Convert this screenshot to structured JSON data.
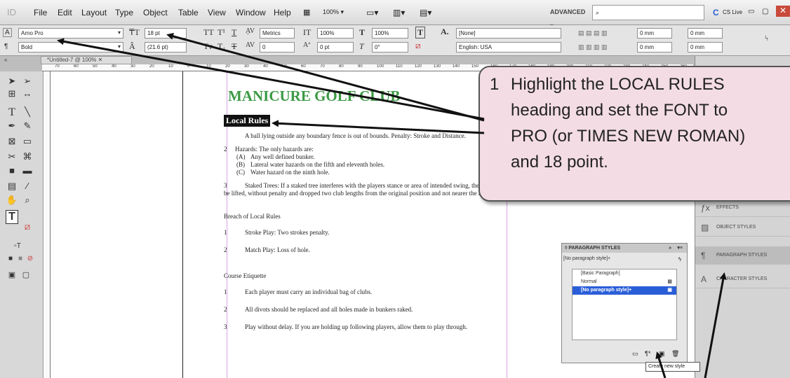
{
  "menubar": {
    "logo": "ID",
    "items": [
      "File",
      "Edit",
      "Layout",
      "Type",
      "Object",
      "Table",
      "View",
      "Window",
      "Help"
    ],
    "zoom": "100%",
    "workspace": "ADVANCED",
    "search_placeholder": "",
    "cslive": "CS Live"
  },
  "control": {
    "font_family": "Arno Pro",
    "font_style": "Bold",
    "font_size": "18 pt",
    "leading": "(21.6 pt)",
    "kerning": "Metrics",
    "tracking": "0",
    "vscale": "100%",
    "hscale": "100%",
    "baseline": "0 pt",
    "skew": "0°",
    "char_style": "[None]",
    "language": "English: USA",
    "indent1": "0 mm",
    "indent2": "0 mm",
    "indent3": "0 mm",
    "indent4": "0 mm"
  },
  "document": {
    "tab_title": "*Untitled-7 @ 100%",
    "ruler_ticks": [
      "70",
      "60",
      "50",
      "40",
      "30",
      "20",
      "10",
      "0",
      "10",
      "20",
      "30",
      "40",
      "50",
      "60",
      "70",
      "80",
      "90",
      "100",
      "110",
      "120",
      "130",
      "140",
      "150",
      "160",
      "170",
      "180",
      "190",
      "200",
      "210",
      "220",
      "230",
      "240",
      "250",
      "260",
      "270",
      "280"
    ],
    "title": "MANICURE GOLF CLUB",
    "local_rules": "Local Rules",
    "rule1": "A ball lying outside any boundary fence is out of bounds.  Penalty: Stroke and Distance.",
    "rule2": "Hazards:  The only hazards are:",
    "rule2a_k": "(A)",
    "rule2a": "Any well defined bunker.",
    "rule2b_k": "(B)",
    "rule2b": "Lateral water hazards on the fifth and eleventh holes.",
    "rule2c_k": "(C)",
    "rule2c": "Water hazard on the ninth hole.",
    "rule3": "Staked Trees:  If a staked tree interferes with the players stance or area of intended swing, the ball must be lifted, without penalty and dropped two club lengths from the original position and not nearer the hole.",
    "breach": "Breach of Local Rules",
    "stroke": "Stroke Play:  Two strokes penalty.",
    "match": "Match Play:  Loss of hole.",
    "etiquette": "Course Etiquette",
    "e1": "Each player must carry an individual bag of clubs.",
    "e2": "All divots should be replaced and all holes made in bunkers raked.",
    "e3": "Play without delay.  If you are holding up following players, allow them to play through."
  },
  "panels": {
    "effects": "EFFECTS",
    "object_styles": "OBJECT STYLES",
    "paragraph_styles": "PARAGRAPH STYLES",
    "character_styles": "CHARACTER STYLES"
  },
  "pstyles": {
    "header": "◊ PARAGRAPH STYLES",
    "current": "[No paragraph style]+",
    "items": [
      "[Basic Paragraph]",
      "Normal",
      "[No paragraph style]+"
    ],
    "tooltip": "Create new style"
  },
  "callout": {
    "number": "1",
    "line1": "Highlight the LOCAL RULES",
    "line2": "heading and set the FONT to",
    "line3": "PRO (or TIMES NEW ROMAN)",
    "line4": "and 18 point."
  }
}
